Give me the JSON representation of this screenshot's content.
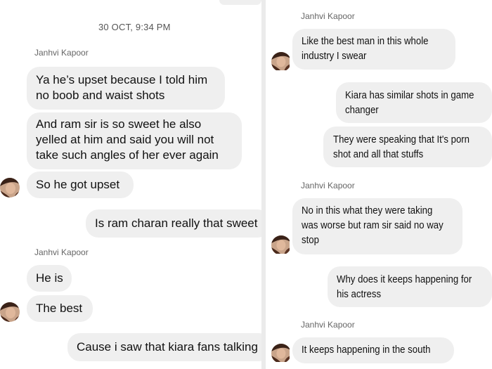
{
  "left": {
    "timestamp": "30 OCT, 9:34 PM",
    "sender_1": "Janhvi Kapoor",
    "msg_1": [
      "Ya he’s upset because I told him",
      "no boob and waist shots"
    ],
    "msg_2": [
      "And ram sir is so sweet he also",
      "yelled at him and said you will not",
      "take such angles of her ever again"
    ],
    "msg_3": "So he got upset",
    "msg_4": "Is ram charan really that sweet",
    "sender_2": "Janhvi Kapoor",
    "msg_5": "He is",
    "msg_6": "The best",
    "msg_7": "Cause i saw that kiara fans talking"
  },
  "right": {
    "sender_1": "Janhvi Kapoor",
    "msg_1": [
      "Like the best man in this whole",
      "industry I swear"
    ],
    "msg_2": [
      "Kiara has similar shots in game",
      "changer"
    ],
    "msg_3": [
      "They were speaking that It's porn",
      "shot and all that stuffs"
    ],
    "sender_2": "Janhvi Kapoor",
    "msg_4": [
      "No in this what they were taking",
      "was worse but ram sir said no way",
      "stop"
    ],
    "msg_5": [
      "Why does it keeps happening for",
      "his actress"
    ],
    "sender_3": "Janhvi Kapoor",
    "msg_6": "It keeps happening in the south"
  },
  "colors": {
    "bubble": "#efefef",
    "background": "#ffffff",
    "text": "#111111",
    "meta": "#666666"
  },
  "icons": {
    "avatar": "profile-photo-avatar"
  }
}
